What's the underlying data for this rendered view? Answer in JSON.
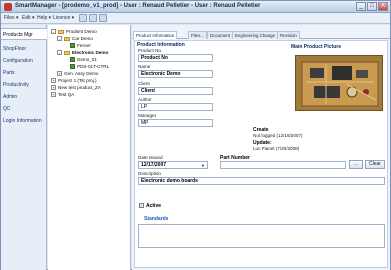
{
  "window": {
    "title": "SmartManager - [prodemo_v1_prod] - User : Renaud Pelletier - User : Renaud Pelletier",
    "minimize": "_",
    "maximize": "□",
    "close": "X"
  },
  "menu": {
    "file": "Files ▾",
    "edit": "Edit ▾",
    "help": "Help ▾",
    "license": "Licence ▾"
  },
  "leftnav": {
    "items": [
      {
        "label": "Products Mgr"
      },
      {
        "label": "ShopFloor"
      },
      {
        "label": "Configuration"
      },
      {
        "label": "Parts"
      },
      {
        "label": "Productivity"
      },
      {
        "label": "Admin"
      },
      {
        "label": "QC"
      },
      {
        "label": "Login Information"
      }
    ]
  },
  "tree": {
    "rows": [
      {
        "label": "Prodsmt Demo"
      },
      {
        "label": "Car Demo"
      },
      {
        "label": "Ferrari"
      },
      {
        "label": "Electronic Demo"
      },
      {
        "label": "Demo_01"
      },
      {
        "label": "PDS-01T-CTRL"
      },
      {
        "label": "Gen. Assy Demo"
      },
      {
        "label": "Project 1 (Tst proj.)"
      },
      {
        "label": "New test product_ZA"
      },
      {
        "label": "Test QA"
      }
    ]
  },
  "tabs": [
    {
      "label": "Product Information"
    },
    {
      "label": "Files..."
    },
    {
      "label": "Document"
    },
    {
      "label": "Engineering Change"
    },
    {
      "label": "Revision"
    }
  ],
  "product": {
    "section_title": "Product Information",
    "product_no_label": "Product No.",
    "product_no_value": "Product No",
    "name_label": "Name",
    "name_value": "Electronic Demo",
    "client_label": "Client",
    "client_value": "Client",
    "author_label": "Author",
    "author_value": "LP",
    "manager_label": "Manager",
    "manager_value": "MP",
    "date_issued_label": "Date Issued",
    "date_issued_value": "12/17/2007",
    "part_number_label": "Part Number",
    "clear_button": "Clear",
    "description_label": "Description",
    "description_value": "Electronic demo boards",
    "picture_title": "Main Product Picture",
    "create_title": "Create",
    "create_text": "Not logged (12/16/2007)",
    "update_title": "Update:",
    "update_text": "Luc Pianel (7/20/2008)",
    "active_label": "Active",
    "active_checked": true,
    "standards_label": "Standards"
  },
  "colors": {
    "accent": "#0b2d62",
    "photo": "#a17a3c"
  }
}
